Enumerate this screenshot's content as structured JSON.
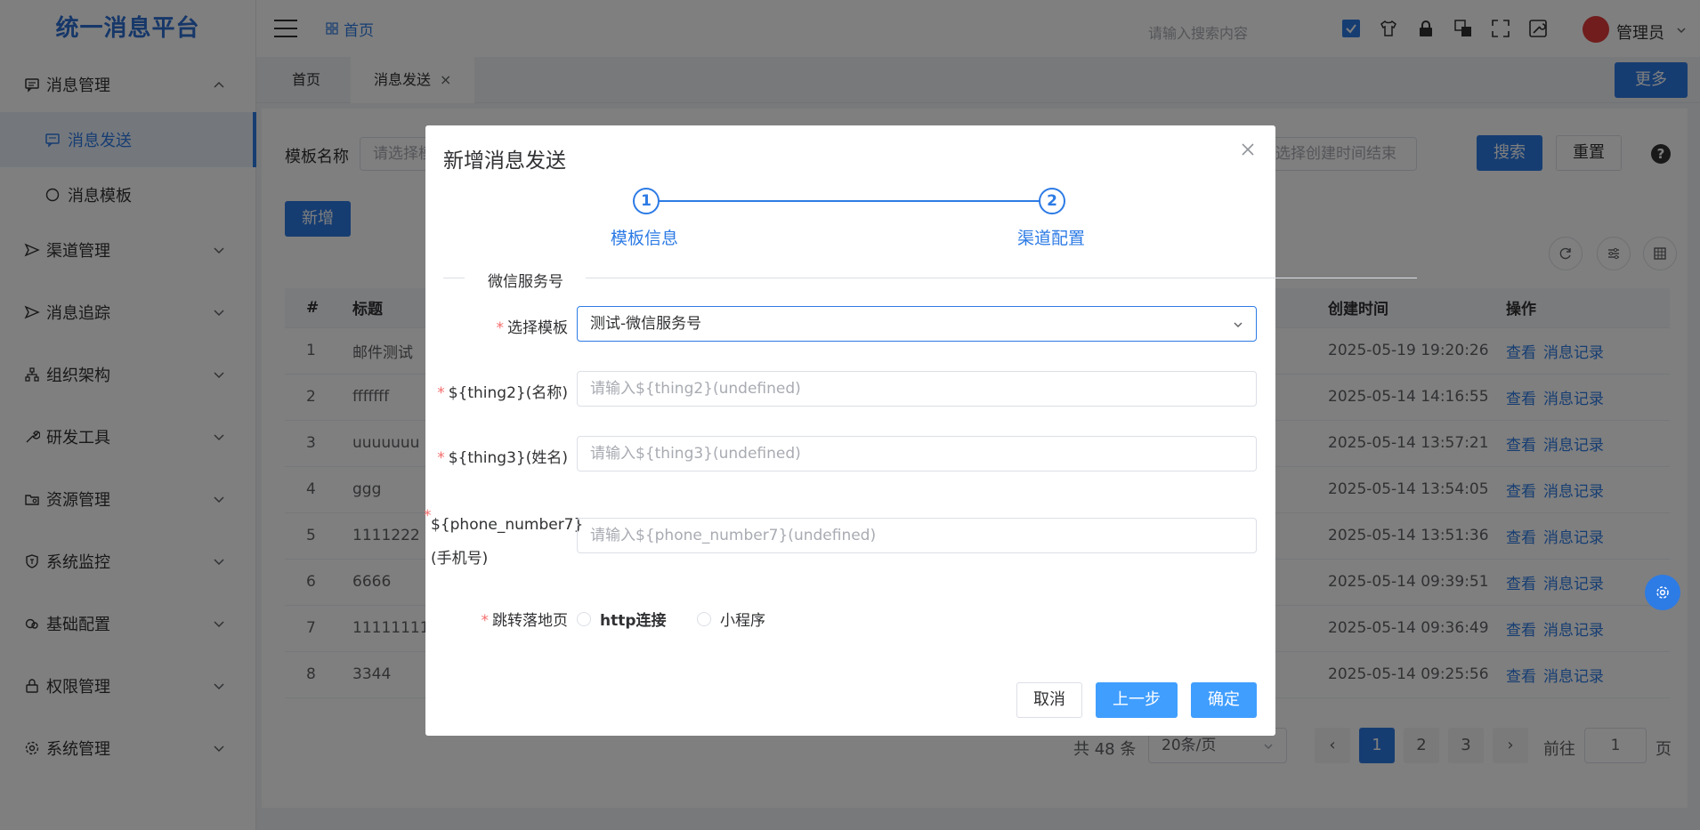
{
  "app": {
    "title": "统一消息平台"
  },
  "sidebar": {
    "items": [
      {
        "label": "消息管理",
        "icon": "message-icon"
      },
      {
        "label": "渠道管理",
        "icon": "send-icon"
      },
      {
        "label": "消息追踪",
        "icon": "send-icon"
      },
      {
        "label": "组织架构",
        "icon": "org-icon"
      },
      {
        "label": "研发工具",
        "icon": "wrench-icon"
      },
      {
        "label": "资源管理",
        "icon": "folder-icon"
      },
      {
        "label": "系统监控",
        "icon": "shield-icon"
      },
      {
        "label": "基础配置",
        "icon": "link-icon"
      },
      {
        "label": "权限管理",
        "icon": "lock-icon"
      },
      {
        "label": "系统管理",
        "icon": "gear-icon"
      }
    ],
    "subitems": [
      {
        "label": "消息发送",
        "icon": "message-icon",
        "active": true
      },
      {
        "label": "消息模板",
        "icon": "circle-icon",
        "active": false
      }
    ]
  },
  "header": {
    "breadcrumb": "首页",
    "search_placeholder": "请输入搜索内容",
    "user": "管理员"
  },
  "tabs": [
    {
      "label": "首页"
    },
    {
      "label": "消息发送",
      "close": "×"
    }
  ],
  "tabbar": {
    "more_label": "更多"
  },
  "filters": {
    "template_label": "模板名称",
    "template_placeholder": "请选择模板",
    "time_end_placeholder": "选择创建时间结束",
    "search_label": "搜索",
    "reset_label": "重置",
    "help": "?"
  },
  "toolbar": {
    "add_label": "新增"
  },
  "table": {
    "headers": {
      "num": "#",
      "title": "标题",
      "created": "创建时间",
      "ops": "操作"
    },
    "rows": [
      {
        "num": "1",
        "title": "邮件测试",
        "created": "2025-05-19 19:20:26"
      },
      {
        "num": "2",
        "title": "fffffff",
        "created": "2025-05-14 14:16:55"
      },
      {
        "num": "3",
        "title": "uuuuuuu",
        "created": "2025-05-14 13:57:21"
      },
      {
        "num": "4",
        "title": "ggg",
        "created": "2025-05-14 13:54:05"
      },
      {
        "num": "5",
        "title": "1111222",
        "created": "2025-05-14 13:51:36"
      },
      {
        "num": "6",
        "title": "6666",
        "created": "2025-05-14 09:39:51"
      },
      {
        "num": "7",
        "title": "11111111",
        "created": "2025-05-14 09:36:49"
      },
      {
        "num": "8",
        "title": "3344",
        "created": "2025-05-14 09:25:56"
      }
    ],
    "op_view": "查看",
    "op_records": "消息记录"
  },
  "pagination": {
    "total": "共 48 条",
    "page_size": "20条/页",
    "prev": "‹",
    "next": "›",
    "pages": [
      "1",
      "2",
      "3"
    ],
    "goto_label": "前往",
    "goto_value": "1",
    "page_suffix": "页"
  },
  "dialog": {
    "title": "新增消息发送",
    "close": "×",
    "steps": [
      {
        "num": "1",
        "label": "模板信息"
      },
      {
        "num": "2",
        "label": "渠道配置"
      }
    ],
    "section": "微信服务号",
    "required_mark": "*",
    "fields": {
      "template_label": "选择模板",
      "template_value": "测试-微信服务号",
      "thing2_label": "${thing2}(名称)",
      "thing2_placeholder": "请输入${thing2}(undefined)",
      "thing3_label": "${thing3}(姓名)",
      "thing3_placeholder": "请输入${thing3}(undefined)",
      "phone_label_1": "${phone_number7}",
      "phone_label_2": "(手机号)",
      "phone_placeholder": "请输入${phone_number7}(undefined)",
      "landing_label": "跳转落地页",
      "radio_http": "http连接",
      "radio_mini": "小程序"
    },
    "buttons": {
      "cancel": "取消",
      "prev": "上一步",
      "ok": "确定"
    }
  },
  "colors": {
    "primary": "#2d7be5",
    "primary_light": "#409eff",
    "danger": "#f56c6c"
  }
}
